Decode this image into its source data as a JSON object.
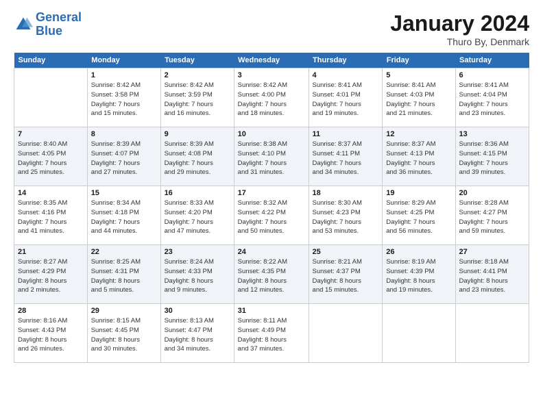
{
  "logo": {
    "line1": "General",
    "line2": "Blue"
  },
  "title": "January 2024",
  "subtitle": "Thuro By, Denmark",
  "days_header": [
    "Sunday",
    "Monday",
    "Tuesday",
    "Wednesday",
    "Thursday",
    "Friday",
    "Saturday"
  ],
  "weeks": [
    [
      {
        "num": "",
        "detail": ""
      },
      {
        "num": "1",
        "detail": "Sunrise: 8:42 AM\nSunset: 3:58 PM\nDaylight: 7 hours\nand 15 minutes."
      },
      {
        "num": "2",
        "detail": "Sunrise: 8:42 AM\nSunset: 3:59 PM\nDaylight: 7 hours\nand 16 minutes."
      },
      {
        "num": "3",
        "detail": "Sunrise: 8:42 AM\nSunset: 4:00 PM\nDaylight: 7 hours\nand 18 minutes."
      },
      {
        "num": "4",
        "detail": "Sunrise: 8:41 AM\nSunset: 4:01 PM\nDaylight: 7 hours\nand 19 minutes."
      },
      {
        "num": "5",
        "detail": "Sunrise: 8:41 AM\nSunset: 4:03 PM\nDaylight: 7 hours\nand 21 minutes."
      },
      {
        "num": "6",
        "detail": "Sunrise: 8:41 AM\nSunset: 4:04 PM\nDaylight: 7 hours\nand 23 minutes."
      }
    ],
    [
      {
        "num": "7",
        "detail": "Sunrise: 8:40 AM\nSunset: 4:05 PM\nDaylight: 7 hours\nand 25 minutes."
      },
      {
        "num": "8",
        "detail": "Sunrise: 8:39 AM\nSunset: 4:07 PM\nDaylight: 7 hours\nand 27 minutes."
      },
      {
        "num": "9",
        "detail": "Sunrise: 8:39 AM\nSunset: 4:08 PM\nDaylight: 7 hours\nand 29 minutes."
      },
      {
        "num": "10",
        "detail": "Sunrise: 8:38 AM\nSunset: 4:10 PM\nDaylight: 7 hours\nand 31 minutes."
      },
      {
        "num": "11",
        "detail": "Sunrise: 8:37 AM\nSunset: 4:11 PM\nDaylight: 7 hours\nand 34 minutes."
      },
      {
        "num": "12",
        "detail": "Sunrise: 8:37 AM\nSunset: 4:13 PM\nDaylight: 7 hours\nand 36 minutes."
      },
      {
        "num": "13",
        "detail": "Sunrise: 8:36 AM\nSunset: 4:15 PM\nDaylight: 7 hours\nand 39 minutes."
      }
    ],
    [
      {
        "num": "14",
        "detail": "Sunrise: 8:35 AM\nSunset: 4:16 PM\nDaylight: 7 hours\nand 41 minutes."
      },
      {
        "num": "15",
        "detail": "Sunrise: 8:34 AM\nSunset: 4:18 PM\nDaylight: 7 hours\nand 44 minutes."
      },
      {
        "num": "16",
        "detail": "Sunrise: 8:33 AM\nSunset: 4:20 PM\nDaylight: 7 hours\nand 47 minutes."
      },
      {
        "num": "17",
        "detail": "Sunrise: 8:32 AM\nSunset: 4:22 PM\nDaylight: 7 hours\nand 50 minutes."
      },
      {
        "num": "18",
        "detail": "Sunrise: 8:30 AM\nSunset: 4:23 PM\nDaylight: 7 hours\nand 53 minutes."
      },
      {
        "num": "19",
        "detail": "Sunrise: 8:29 AM\nSunset: 4:25 PM\nDaylight: 7 hours\nand 56 minutes."
      },
      {
        "num": "20",
        "detail": "Sunrise: 8:28 AM\nSunset: 4:27 PM\nDaylight: 7 hours\nand 59 minutes."
      }
    ],
    [
      {
        "num": "21",
        "detail": "Sunrise: 8:27 AM\nSunset: 4:29 PM\nDaylight: 8 hours\nand 2 minutes."
      },
      {
        "num": "22",
        "detail": "Sunrise: 8:25 AM\nSunset: 4:31 PM\nDaylight: 8 hours\nand 5 minutes."
      },
      {
        "num": "23",
        "detail": "Sunrise: 8:24 AM\nSunset: 4:33 PM\nDaylight: 8 hours\nand 9 minutes."
      },
      {
        "num": "24",
        "detail": "Sunrise: 8:22 AM\nSunset: 4:35 PM\nDaylight: 8 hours\nand 12 minutes."
      },
      {
        "num": "25",
        "detail": "Sunrise: 8:21 AM\nSunset: 4:37 PM\nDaylight: 8 hours\nand 15 minutes."
      },
      {
        "num": "26",
        "detail": "Sunrise: 8:19 AM\nSunset: 4:39 PM\nDaylight: 8 hours\nand 19 minutes."
      },
      {
        "num": "27",
        "detail": "Sunrise: 8:18 AM\nSunset: 4:41 PM\nDaylight: 8 hours\nand 23 minutes."
      }
    ],
    [
      {
        "num": "28",
        "detail": "Sunrise: 8:16 AM\nSunset: 4:43 PM\nDaylight: 8 hours\nand 26 minutes."
      },
      {
        "num": "29",
        "detail": "Sunrise: 8:15 AM\nSunset: 4:45 PM\nDaylight: 8 hours\nand 30 minutes."
      },
      {
        "num": "30",
        "detail": "Sunrise: 8:13 AM\nSunset: 4:47 PM\nDaylight: 8 hours\nand 34 minutes."
      },
      {
        "num": "31",
        "detail": "Sunrise: 8:11 AM\nSunset: 4:49 PM\nDaylight: 8 hours\nand 37 minutes."
      },
      {
        "num": "",
        "detail": ""
      },
      {
        "num": "",
        "detail": ""
      },
      {
        "num": "",
        "detail": ""
      }
    ]
  ]
}
